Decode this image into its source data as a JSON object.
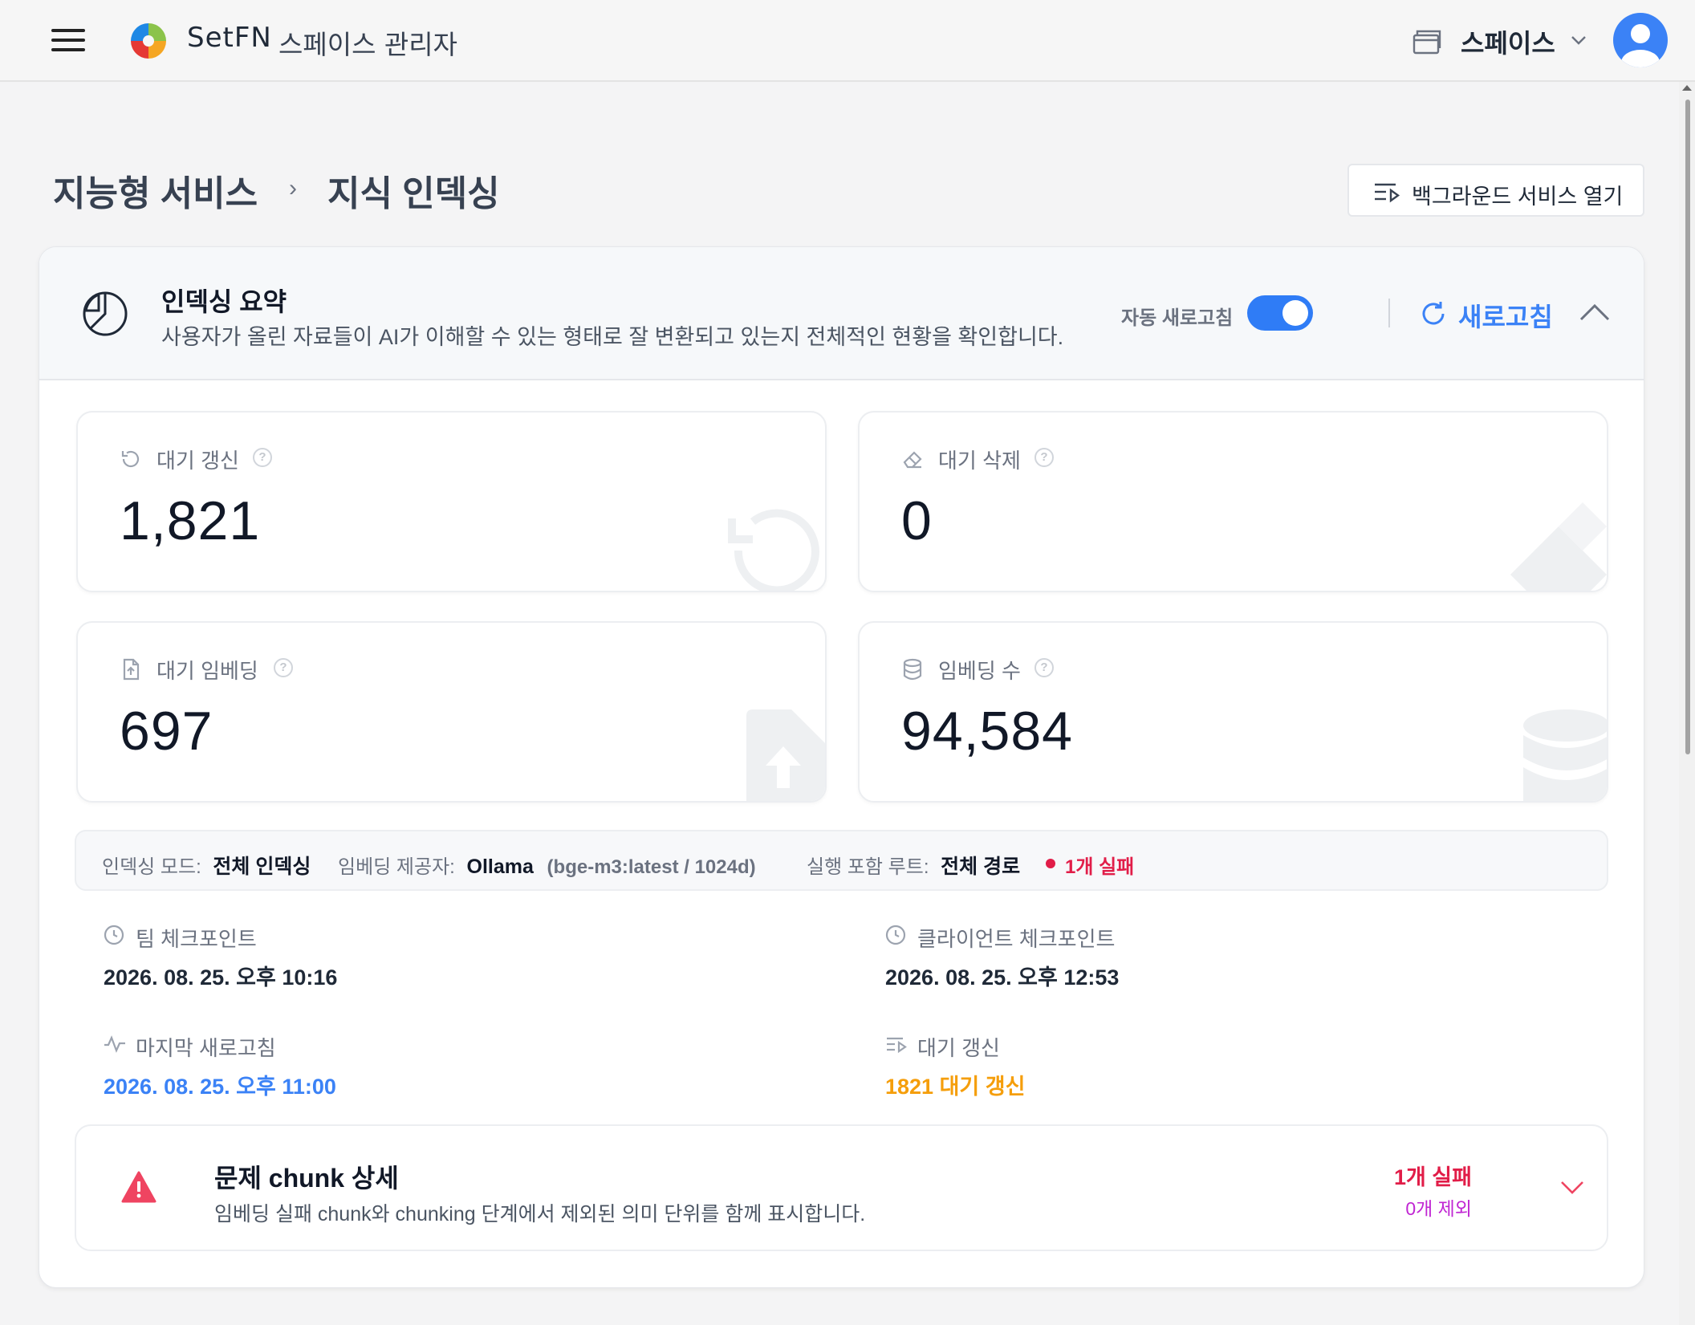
{
  "header": {
    "brand": "SetFN",
    "subtitle": "스페이스 관리자",
    "space_selector": "스페이스"
  },
  "breadcrumb": {
    "parent": "지능형 서비스",
    "separator": "›",
    "current": "지식 인덱싱"
  },
  "actions": {
    "open_background": "백그라운드 서비스 열기"
  },
  "summary": {
    "title": "인덱싱 요약",
    "description": "사용자가 올린 자료들이 AI가 이해할 수 있는 형태로 잘 변환되고 있는지 전체적인 현황을 확인합니다.",
    "auto_refresh_label": "자동 새로고침",
    "auto_refresh_on": true,
    "refresh_label": "새로고침"
  },
  "stats": [
    {
      "label": "대기 갱신",
      "value": "1,821",
      "icon": "refresh-icon"
    },
    {
      "label": "대기 삭제",
      "value": "0",
      "icon": "eraser-icon"
    },
    {
      "label": "대기 임베딩",
      "value": "697",
      "icon": "file-upload-icon"
    },
    {
      "label": "임베딩 수",
      "value": "94,584",
      "icon": "database-icon"
    }
  ],
  "info": {
    "mode_label": "인덱싱 모드:",
    "mode_value": "전체 인덱싱",
    "provider_label": "임베딩 제공자:",
    "provider_value": "Ollama",
    "provider_model": "(bge-m3:latest / 1024d)",
    "root_label": "실행 포함 루트:",
    "root_value": "전체 경로",
    "fail_text": "1개 실패"
  },
  "details": {
    "team_checkpoint_label": "팀 체크포인트",
    "team_checkpoint_value": "2026. 08. 25. 오후 10:16",
    "client_checkpoint_label": "클라이언트 체크포인트",
    "client_checkpoint_value": "2026. 08. 25. 오후 12:53",
    "last_refresh_label": "마지막 새로고침",
    "last_refresh_value": "2026. 08. 25. 오후 11:00",
    "pending_update_label": "대기 갱신",
    "pending_update_value": "1821 대기 갱신"
  },
  "problem": {
    "title": "문제 chunk 상세",
    "description": "임베딩 실패 chunk와 chunking 단계에서 제외된 의미 단위를 함께 표시합니다.",
    "fail_count": "1개 실패",
    "excluded_count": "0개 제외"
  },
  "colors": {
    "accent": "#3b82f6",
    "danger": "#e11d48",
    "warning": "#f59e0b",
    "excluded": "#c026d3"
  }
}
